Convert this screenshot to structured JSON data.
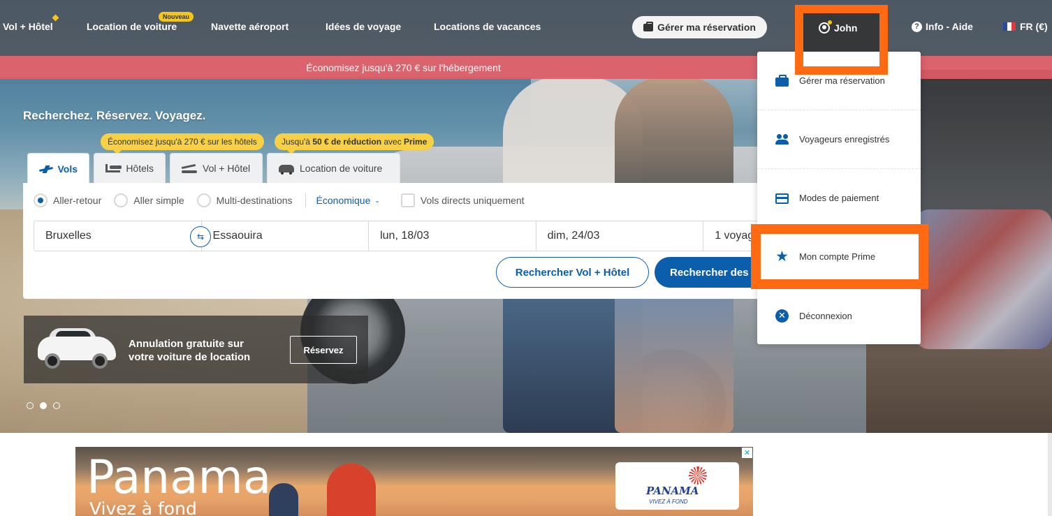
{
  "nav": {
    "items": [
      "Vol + Hôtel",
      "Location de voiture",
      "Navette aéroport",
      "Idées de voyage",
      "Locations de vacances"
    ],
    "badge_new": "Nouveau",
    "manage_booking": "Gérer ma réservation",
    "user_name": "John",
    "help": "Info - Aide",
    "language": "FR (€)"
  },
  "promo_banner": "Économisez jusqu'à 270 € sur l'hébergement",
  "hero": {
    "title": "Recherchez. Réservez. Voyagez.",
    "tip_hotels": "Économisez jusqu'à 270 € sur les hôtels",
    "tip_prime_prefix": "Jusqu'à ",
    "tip_prime_bold": "50 € de réduction",
    "tip_prime_mid": " avec ",
    "tip_prime_brand": "Prime"
  },
  "tabs": [
    {
      "label": "Vols",
      "active": true
    },
    {
      "label": "Hôtels",
      "active": false
    },
    {
      "label": "Vol + Hôtel",
      "active": false
    },
    {
      "label": "Location de voiture",
      "active": false
    }
  ],
  "search": {
    "trip_types": [
      "Aller-retour",
      "Aller simple",
      "Multi-destinations"
    ],
    "selected_trip_type": "Aller-retour",
    "cabin_class": "Économique",
    "direct_only_label": "Vols directs uniquement",
    "direct_only_checked": false,
    "origin": "Bruxelles",
    "destination": "Essaouira",
    "depart_date": "lun, 18/03",
    "return_date": "dim, 24/03",
    "travellers": "1 voyag",
    "btn_flight_hotel": "Rechercher Vol + Hôtel",
    "btn_flights": "Rechercher des"
  },
  "car_promo": {
    "line1": "Annulation gratuite sur",
    "line2": "votre voiture de location",
    "button": "Réservez"
  },
  "carousel": {
    "count": 3,
    "active": 2
  },
  "user_menu": {
    "items": [
      {
        "label": "Gérer ma réservation",
        "icon": "briefcase-icon"
      },
      {
        "label": "Voyageurs enregistrés",
        "icon": "users-icon"
      },
      {
        "label": "Modes de paiement",
        "icon": "credit-card-icon"
      },
      {
        "label": "Mon compte Prime",
        "icon": "star-icon"
      },
      {
        "label": "Déconnexion",
        "icon": "close-circle-icon"
      }
    ],
    "highlighted": "Mon compte Prime"
  },
  "ad": {
    "title": "Panama",
    "subtitle": "Vivez à fond",
    "logo_text": "PANAMA",
    "logo_sub": "VIVEZ À FOND"
  },
  "colors": {
    "brand_blue": "#0a5eab",
    "highlight_orange": "#ff6a13",
    "promo_red": "#e05c67",
    "tip_yellow": "#f7d046"
  }
}
